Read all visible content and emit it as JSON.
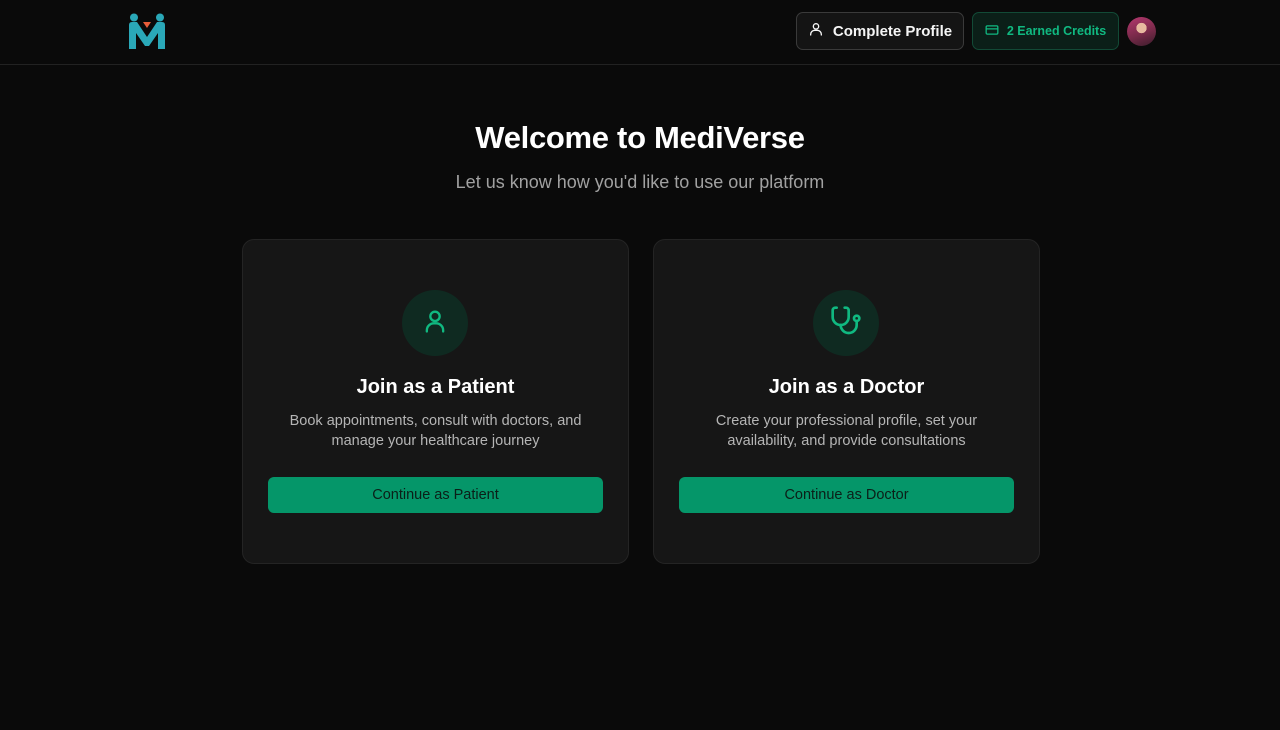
{
  "app": {
    "logo_icon": "mediverse-logo-icon"
  },
  "header": {
    "profile_button": {
      "label": "Complete Profile",
      "icon": "user-icon"
    },
    "credits_button": {
      "label": "2 Earned Credits",
      "icon": "credit-card-icon"
    },
    "avatar": {
      "icon": "user-avatar"
    }
  },
  "hero": {
    "title": "Welcome to MediVerse",
    "subtitle": "Let us know how you'd like to use our platform"
  },
  "cards": [
    {
      "icon": "user-icon",
      "title": "Join as a Patient",
      "description": "Book appointments, consult with doctors, and manage your healthcare journey",
      "button": "Continue as Patient"
    },
    {
      "icon": "stethoscope-icon",
      "title": "Join as a Doctor",
      "description": "Create your professional profile, set your availability, and provide consultations",
      "button": "Continue as Doctor"
    }
  ],
  "colors": {
    "background": "#0a0a0a",
    "card": "#161616",
    "accent": "#059669",
    "accent_text": "#10b981"
  }
}
